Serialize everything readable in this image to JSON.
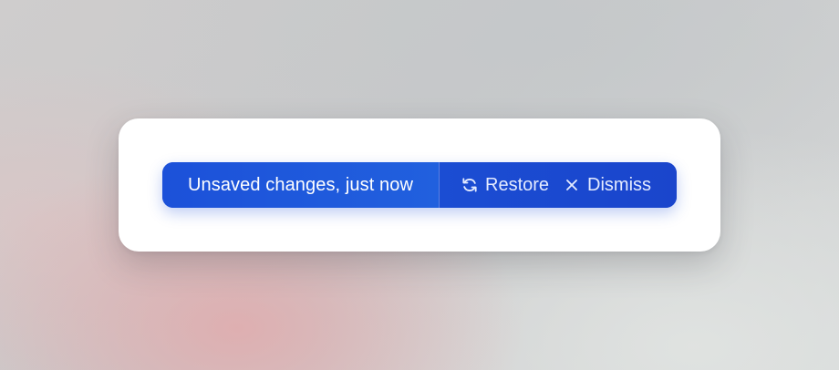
{
  "toast": {
    "message": "Unsaved changes, just now",
    "actions": [
      {
        "label": "Restore",
        "icon": "refresh-icon"
      },
      {
        "label": "Dismiss",
        "icon": "close-icon"
      }
    ]
  },
  "colors": {
    "toast_background": "#1d4fd6",
    "toast_text": "#ffffff",
    "action_text": "#e4ebff",
    "card_background": "#ffffff"
  }
}
